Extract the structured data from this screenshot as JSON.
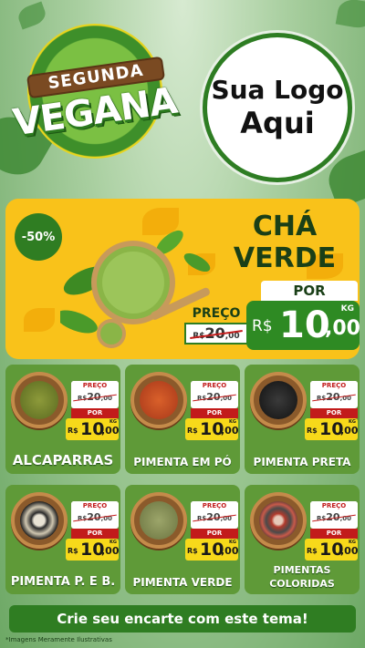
{
  "badge": {
    "line1": "SEGUNDA",
    "line2": "VEGANA"
  },
  "logo": {
    "line1": "Sua Logo",
    "line2": "Aqui"
  },
  "featured": {
    "discount": "-50%",
    "title_line1": "CHÁ",
    "title_line2": "VERDE",
    "preco_label": "PREÇO",
    "old_price_currency": "R$",
    "old_price": "20",
    "old_price_cents": ",00",
    "por_label": "POR",
    "currency": "R$",
    "price_int": "10",
    "price_dec": ",00",
    "unit": "KG"
  },
  "products": [
    {
      "name": "ALCAPARRAS",
      "preco_label": "PREÇO",
      "old_currency": "R$",
      "old_price": "20",
      "old_cents": ",00",
      "por_label": "POR",
      "currency": "R$",
      "price_int": "10",
      "price_dec": ",00",
      "unit": "KG",
      "color": "#6b7a2e"
    },
    {
      "name": "PIMENTA EM PÓ",
      "preco_label": "PREÇO",
      "old_currency": "R$",
      "old_price": "20",
      "old_cents": ",00",
      "por_label": "POR",
      "currency": "R$",
      "price_int": "10",
      "price_dec": ",00",
      "unit": "KG",
      "color": "#c8481d"
    },
    {
      "name": "PIMENTA PRETA",
      "preco_label": "PREÇO",
      "old_currency": "R$",
      "old_price": "20",
      "old_cents": ",00",
      "por_label": "POR",
      "currency": "R$",
      "price_int": "10",
      "price_dec": ",00",
      "unit": "KG",
      "color": "#222222"
    },
    {
      "name": "PIMENTA P. E B.",
      "preco_label": "PREÇO",
      "old_currency": "R$",
      "old_price": "20",
      "old_cents": ",00",
      "por_label": "POR",
      "currency": "R$",
      "price_int": "10",
      "price_dec": ",00",
      "unit": "KG",
      "color": "#5a4b3c"
    },
    {
      "name": "PIMENTA VERDE",
      "preco_label": "PREÇO",
      "old_currency": "R$",
      "old_price": "20",
      "old_cents": ",00",
      "por_label": "POR",
      "currency": "R$",
      "price_int": "10",
      "price_dec": ",00",
      "unit": "KG",
      "color": "#7e8a4a"
    },
    {
      "name_line1": "PIMENTAS",
      "name_line2": "COLORIDAS",
      "preco_label": "PREÇO",
      "old_currency": "R$",
      "old_price": "20",
      "old_cents": ",00",
      "por_label": "POR",
      "currency": "R$",
      "price_int": "10",
      "price_dec": ",00",
      "unit": "KG",
      "color": "#a23a2e"
    }
  ],
  "cta": "Crie seu encarte com este tema!",
  "note": "*Imagens Meramente Ilustrativas",
  "colors": {
    "primary_green": "#2f7d22",
    "yellow": "#f9c21a",
    "price_red": "#c21b1b"
  }
}
